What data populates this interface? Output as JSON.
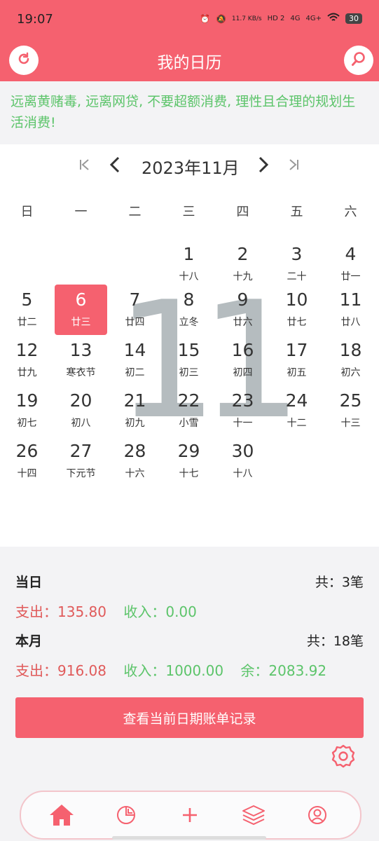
{
  "status_bar": {
    "time": "19:07",
    "net_speed": "11.7 KB/s",
    "hd": "HD 2",
    "signal1": "4G",
    "signal2": "4G+",
    "battery": "30"
  },
  "header": {
    "title": "我的日历",
    "refresh_icon": "refresh-icon",
    "search_icon": "search-icon"
  },
  "notice": "远离黄赌毒, 远离网贷, 不要超额消费, 理性且合理的规划生活消费!",
  "calendar": {
    "month_label": "2023年11月",
    "big_month": "11",
    "weekdays": [
      "日",
      "一",
      "二",
      "三",
      "四",
      "五",
      "六"
    ],
    "days": [
      {
        "d": "1",
        "l": "十八"
      },
      {
        "d": "2",
        "l": "十九"
      },
      {
        "d": "3",
        "l": "二十"
      },
      {
        "d": "4",
        "l": "廿一"
      },
      {
        "d": "5",
        "l": "廿二"
      },
      {
        "d": "6",
        "l": "廿三"
      },
      {
        "d": "7",
        "l": "廿四"
      },
      {
        "d": "8",
        "l": "立冬"
      },
      {
        "d": "9",
        "l": "廿六"
      },
      {
        "d": "10",
        "l": "廿七"
      },
      {
        "d": "11",
        "l": "廿八"
      },
      {
        "d": "12",
        "l": "廿九"
      },
      {
        "d": "13",
        "l": "寒衣节"
      },
      {
        "d": "14",
        "l": "初二"
      },
      {
        "d": "15",
        "l": "初三"
      },
      {
        "d": "16",
        "l": "初四"
      },
      {
        "d": "17",
        "l": "初五"
      },
      {
        "d": "18",
        "l": "初六"
      },
      {
        "d": "19",
        "l": "初七"
      },
      {
        "d": "20",
        "l": "初八"
      },
      {
        "d": "21",
        "l": "初九"
      },
      {
        "d": "22",
        "l": "小雪"
      },
      {
        "d": "23",
        "l": "十一"
      },
      {
        "d": "24",
        "l": "十二"
      },
      {
        "d": "25",
        "l": "十三"
      },
      {
        "d": "26",
        "l": "十四"
      },
      {
        "d": "27",
        "l": "下元节"
      },
      {
        "d": "28",
        "l": "十六"
      },
      {
        "d": "29",
        "l": "十七"
      },
      {
        "d": "30",
        "l": "十八"
      }
    ],
    "selected_day": "6"
  },
  "summary": {
    "today_label": "当日",
    "today_count": "共：3笔",
    "today_expense": "支出：135.80",
    "today_income": "收入：0.00",
    "month_label": "本月",
    "month_count": "共：18笔",
    "month_expense": "支出：916.08",
    "month_income": "收入：1000.00",
    "month_balance": "余：2083.92",
    "view_button": "查看当前日期账单记录"
  },
  "tabbar": {
    "icons": [
      "home-icon",
      "chart-icon",
      "add-icon",
      "layers-icon",
      "user-icon"
    ],
    "accent": "#f5616f"
  },
  "colors": {
    "primary": "#f5616f",
    "income": "#5cc46a",
    "expense": "#e05a5a"
  }
}
